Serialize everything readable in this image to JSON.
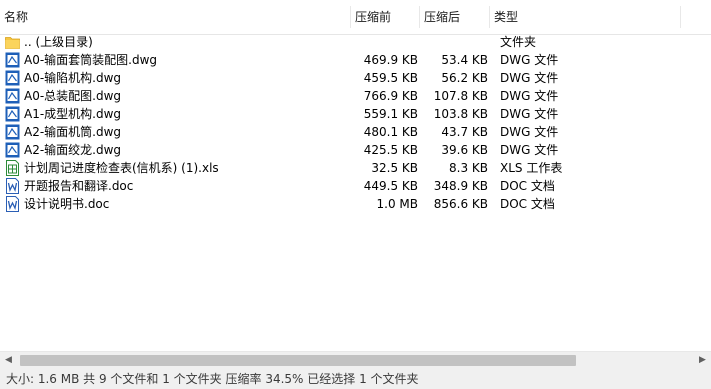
{
  "columns": {
    "name": "名称",
    "original_size": "压缩前",
    "compressed_size": "压缩后",
    "type": "类型"
  },
  "files": [
    {
      "icon": "folder-icon",
      "name": ".. (上级目录)",
      "original_size": "",
      "compressed_size": "",
      "type": "文件夹"
    },
    {
      "icon": "dwg-file-icon",
      "name": "A0-输面套筒装配图.dwg",
      "original_size": "469.9 KB",
      "compressed_size": "53.4 KB",
      "type": "DWG 文件"
    },
    {
      "icon": "dwg-file-icon",
      "name": "A0-输陷机构.dwg",
      "original_size": "459.5 KB",
      "compressed_size": "56.2 KB",
      "type": "DWG 文件"
    },
    {
      "icon": "dwg-file-icon",
      "name": "A0-总装配图.dwg",
      "original_size": "766.9 KB",
      "compressed_size": "107.8 KB",
      "type": "DWG 文件"
    },
    {
      "icon": "dwg-file-icon",
      "name": "A1-成型机构.dwg",
      "original_size": "559.1 KB",
      "compressed_size": "103.8 KB",
      "type": "DWG 文件"
    },
    {
      "icon": "dwg-file-icon",
      "name": "A2-输面机筒.dwg",
      "original_size": "480.1 KB",
      "compressed_size": "43.7 KB",
      "type": "DWG 文件"
    },
    {
      "icon": "dwg-file-icon",
      "name": "A2-输面绞龙.dwg",
      "original_size": "425.5 KB",
      "compressed_size": "39.6 KB",
      "type": "DWG 文件"
    },
    {
      "icon": "xls-file-icon",
      "name": "计划周记进度检查表(信机系) (1).xls",
      "original_size": "32.5 KB",
      "compressed_size": "8.3 KB",
      "type": "XLS 工作表"
    },
    {
      "icon": "doc-file-icon",
      "name": "开题报告和翻译.doc",
      "original_size": "449.5 KB",
      "compressed_size": "348.9 KB",
      "type": "DOC 文档"
    },
    {
      "icon": "doc-file-icon",
      "name": "设计说明书.doc",
      "original_size": "1.0 MB",
      "compressed_size": "856.6 KB",
      "type": "DOC 文档"
    }
  ],
  "statusbar": {
    "text": "大小: 1.6 MB 共 9 个文件和 1 个文件夹 压缩率 34.5% 已经选择 1 个文件夹"
  },
  "colors": {
    "folder": "#f5c542",
    "dwg_blue": "#1e5fb8",
    "xls_green": "#2e8b3a",
    "doc_blue": "#2b5fb5"
  }
}
